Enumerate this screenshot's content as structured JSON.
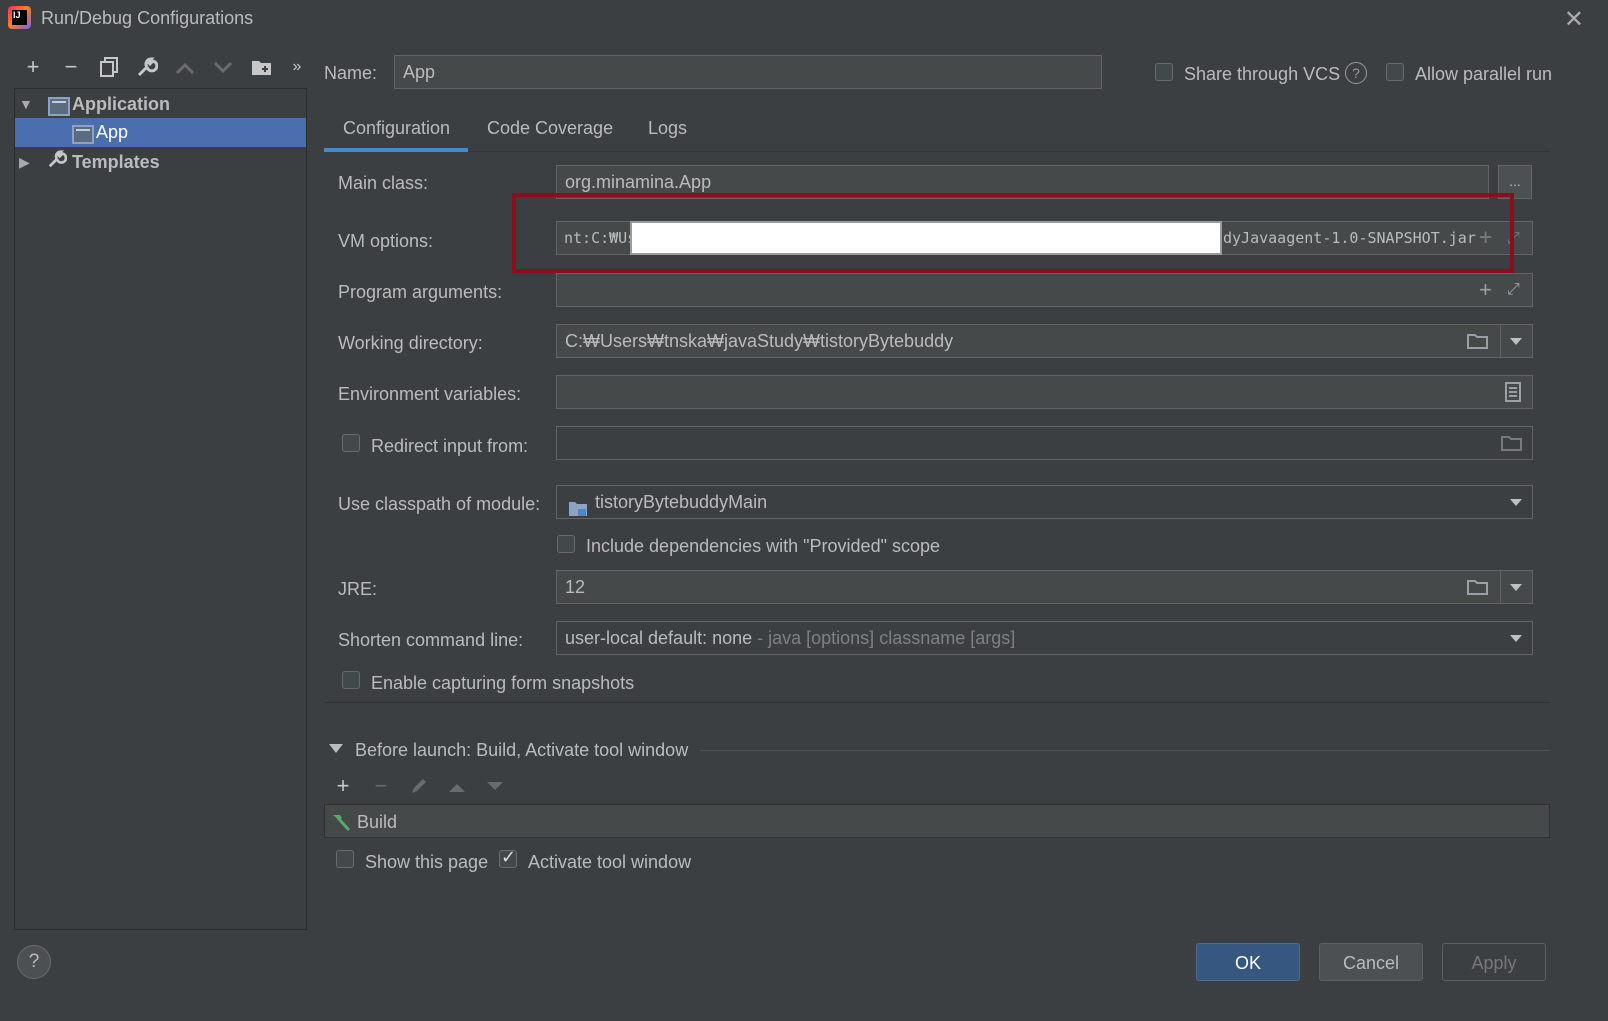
{
  "window": {
    "title": "Run/Debug Configurations"
  },
  "toolbar": {
    "icons": [
      "add-icon",
      "remove-icon",
      "copy-icon",
      "wrench-icon",
      "arrow-up-icon",
      "arrow-down-icon",
      "folder-add-icon",
      "more-icon"
    ]
  },
  "tree": {
    "application_label": "Application",
    "app_label": "App",
    "templates_label": "Templates"
  },
  "header": {
    "name_label": "Name:",
    "name_value": "App",
    "share_vcs_label": "Share through VCS",
    "allow_parallel_label": "Allow parallel run"
  },
  "tabs": [
    {
      "label": "Configuration",
      "active": true
    },
    {
      "label": "Code Coverage",
      "active": false
    },
    {
      "label": "Logs",
      "active": false
    }
  ],
  "config": {
    "main_class_label": "Main class:",
    "main_class_value": "org.minamina.App",
    "main_class_browse": "...",
    "vm_options_label": "VM options:",
    "vm_options_value_left": "nt:C:₩Us",
    "vm_options_value_right": "dyJavaagent-1.0-SNAPSHOT.jar",
    "program_args_label": "Program arguments:",
    "working_dir_label": "Working directory:",
    "working_dir_value": "C:₩Users₩tnska₩javaStudy₩tistoryBytebuddy",
    "env_vars_label": "Environment variables:",
    "redirect_label": "Redirect input from:",
    "classpath_label": "Use classpath of module:",
    "classpath_value": "tistoryBytebuddyMain",
    "include_deps_label": "Include dependencies with \"Provided\" scope",
    "jre_label": "JRE:",
    "jre_value": "12",
    "shorten_label": "Shorten command line:",
    "shorten_value": "user-local default: none",
    "shorten_hint": " - java [options] classname [args]",
    "snapshots_label": "Enable capturing form snapshots"
  },
  "before_launch": {
    "header": "Before launch: Build, Activate tool window",
    "items": [
      "Build"
    ],
    "show_page_label": "Show this page",
    "activate_label": "Activate tool window"
  },
  "footer": {
    "help_label": "?",
    "ok_label": "OK",
    "cancel_label": "Cancel",
    "apply_label": "Apply"
  },
  "colors": {
    "background": "#3c3f41",
    "selection": "#4b6eaf",
    "primary_button": "#365880",
    "highlight_box": "#8b0d1e"
  }
}
